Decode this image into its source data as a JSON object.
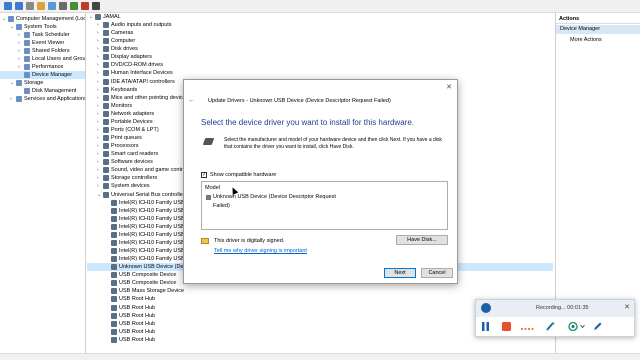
{
  "toolbar": {
    "buttons": [
      "back",
      "forward",
      "up",
      "properties",
      "help",
      "scan",
      "update",
      "uninstall",
      "disable"
    ]
  },
  "left_tree": [
    {
      "label": "Computer Management (Local",
      "indent": 0,
      "twisty": "v"
    },
    {
      "label": "System Tools",
      "indent": 1,
      "twisty": "v"
    },
    {
      "label": "Task Scheduler",
      "indent": 2,
      "twisty": ">"
    },
    {
      "label": "Event Viewer",
      "indent": 2,
      "twisty": ">"
    },
    {
      "label": "Shared Folders",
      "indent": 2,
      "twisty": ">"
    },
    {
      "label": "Local Users and Groups",
      "indent": 2,
      "twisty": ">"
    },
    {
      "label": "Performance",
      "indent": 2,
      "twisty": ">"
    },
    {
      "label": "Device Manager",
      "indent": 2,
      "twisty": "",
      "selected": true
    },
    {
      "label": "Storage",
      "indent": 1,
      "twisty": "v"
    },
    {
      "label": "Disk Management",
      "indent": 2,
      "twisty": ""
    },
    {
      "label": "Services and Applications",
      "indent": 1,
      "twisty": ">"
    }
  ],
  "device_tree": [
    {
      "label": "JAMAL",
      "indent": 0,
      "twisty": "v"
    },
    {
      "label": "Audio inputs and outputs",
      "indent": 1,
      "twisty": ">"
    },
    {
      "label": "Cameras",
      "indent": 1,
      "twisty": ">"
    },
    {
      "label": "Computer",
      "indent": 1,
      "twisty": ">"
    },
    {
      "label": "Disk drives",
      "indent": 1,
      "twisty": ">"
    },
    {
      "label": "Display adapters",
      "indent": 1,
      "twisty": ">"
    },
    {
      "label": "DVD/CD-ROM drives",
      "indent": 1,
      "twisty": ">"
    },
    {
      "label": "Human Interface Devices",
      "indent": 1,
      "twisty": ">"
    },
    {
      "label": "IDE ATA/ATAPI controllers",
      "indent": 1,
      "twisty": ">"
    },
    {
      "label": "Keyboards",
      "indent": 1,
      "twisty": ">"
    },
    {
      "label": "Mice and other pointing devices",
      "indent": 1,
      "twisty": ">"
    },
    {
      "label": "Monitors",
      "indent": 1,
      "twisty": ">"
    },
    {
      "label": "Network adapters",
      "indent": 1,
      "twisty": ">"
    },
    {
      "label": "Portable Devices",
      "indent": 1,
      "twisty": ">"
    },
    {
      "label": "Ports (COM & LPT)",
      "indent": 1,
      "twisty": ">"
    },
    {
      "label": "Print queues",
      "indent": 1,
      "twisty": ">"
    },
    {
      "label": "Processors",
      "indent": 1,
      "twisty": ">"
    },
    {
      "label": "Smart card readers",
      "indent": 1,
      "twisty": ">"
    },
    {
      "label": "Software devices",
      "indent": 1,
      "twisty": ">"
    },
    {
      "label": "Sound, video and game controllers",
      "indent": 1,
      "twisty": ">"
    },
    {
      "label": "Storage controllers",
      "indent": 1,
      "twisty": ">"
    },
    {
      "label": "System devices",
      "indent": 1,
      "twisty": ">"
    },
    {
      "label": "Universal Serial Bus controllers",
      "indent": 1,
      "twisty": "v"
    },
    {
      "label": "Intel(R) ICH10 Family USB",
      "indent": 2,
      "twisty": ""
    },
    {
      "label": "Intel(R) ICH10 Family USB",
      "indent": 2,
      "twisty": ""
    },
    {
      "label": "Intel(R) ICH10 Family USB",
      "indent": 2,
      "twisty": ""
    },
    {
      "label": "Intel(R) ICH10 Family USB",
      "indent": 2,
      "twisty": ""
    },
    {
      "label": "Intel(R) ICH10 Family USB",
      "indent": 2,
      "twisty": ""
    },
    {
      "label": "Intel(R) ICH10 Family USB",
      "indent": 2,
      "twisty": ""
    },
    {
      "label": "Intel(R) ICH10 Family USB",
      "indent": 2,
      "twisty": ""
    },
    {
      "label": "Intel(R) ICH10 Family USB",
      "indent": 2,
      "twisty": ""
    },
    {
      "label": "Unknown USB Device (Devi",
      "indent": 2,
      "twisty": "",
      "selected": true
    },
    {
      "label": "USB Composite Device",
      "indent": 2,
      "twisty": ""
    },
    {
      "label": "USB Composite Device",
      "indent": 2,
      "twisty": ""
    },
    {
      "label": "USB Mass Storage Device",
      "indent": 2,
      "twisty": ""
    },
    {
      "label": "USB Root Hub",
      "indent": 2,
      "twisty": ""
    },
    {
      "label": "USB Root Hub",
      "indent": 2,
      "twisty": ""
    },
    {
      "label": "USB Root Hub",
      "indent": 2,
      "twisty": ""
    },
    {
      "label": "USB Root Hub",
      "indent": 2,
      "twisty": ""
    },
    {
      "label": "USB Root Hub",
      "indent": 2,
      "twisty": ""
    },
    {
      "label": "USB Root Hub",
      "indent": 2,
      "twisty": ""
    }
  ],
  "actions": {
    "header": "Actions",
    "selected": "Device Manager",
    "more": "More Actions"
  },
  "dialog": {
    "title": "Update Drivers - Unknown USB Device (Device Descriptor Request Failed)",
    "heading": "Select the device driver you want to install for this hardware.",
    "description": "Select the manufacturer and model of your hardware device and then click Next. If you have a disk that contains the driver you want to install, click Have Disk.",
    "checkbox_label": "Show compatible hardware",
    "checkbox_checked": true,
    "list_header": "Model",
    "list_items": [
      "Unknown USB Device (Device Descriptor Request Failed)"
    ],
    "signed_text": "This driver is digitally signed.",
    "signing_link": "Tell me why driver signing is important",
    "have_disk": "Have Disk...",
    "next": "Next",
    "cancel": "Cancel"
  },
  "recorder": {
    "status": "Recording... 00:01:35"
  }
}
